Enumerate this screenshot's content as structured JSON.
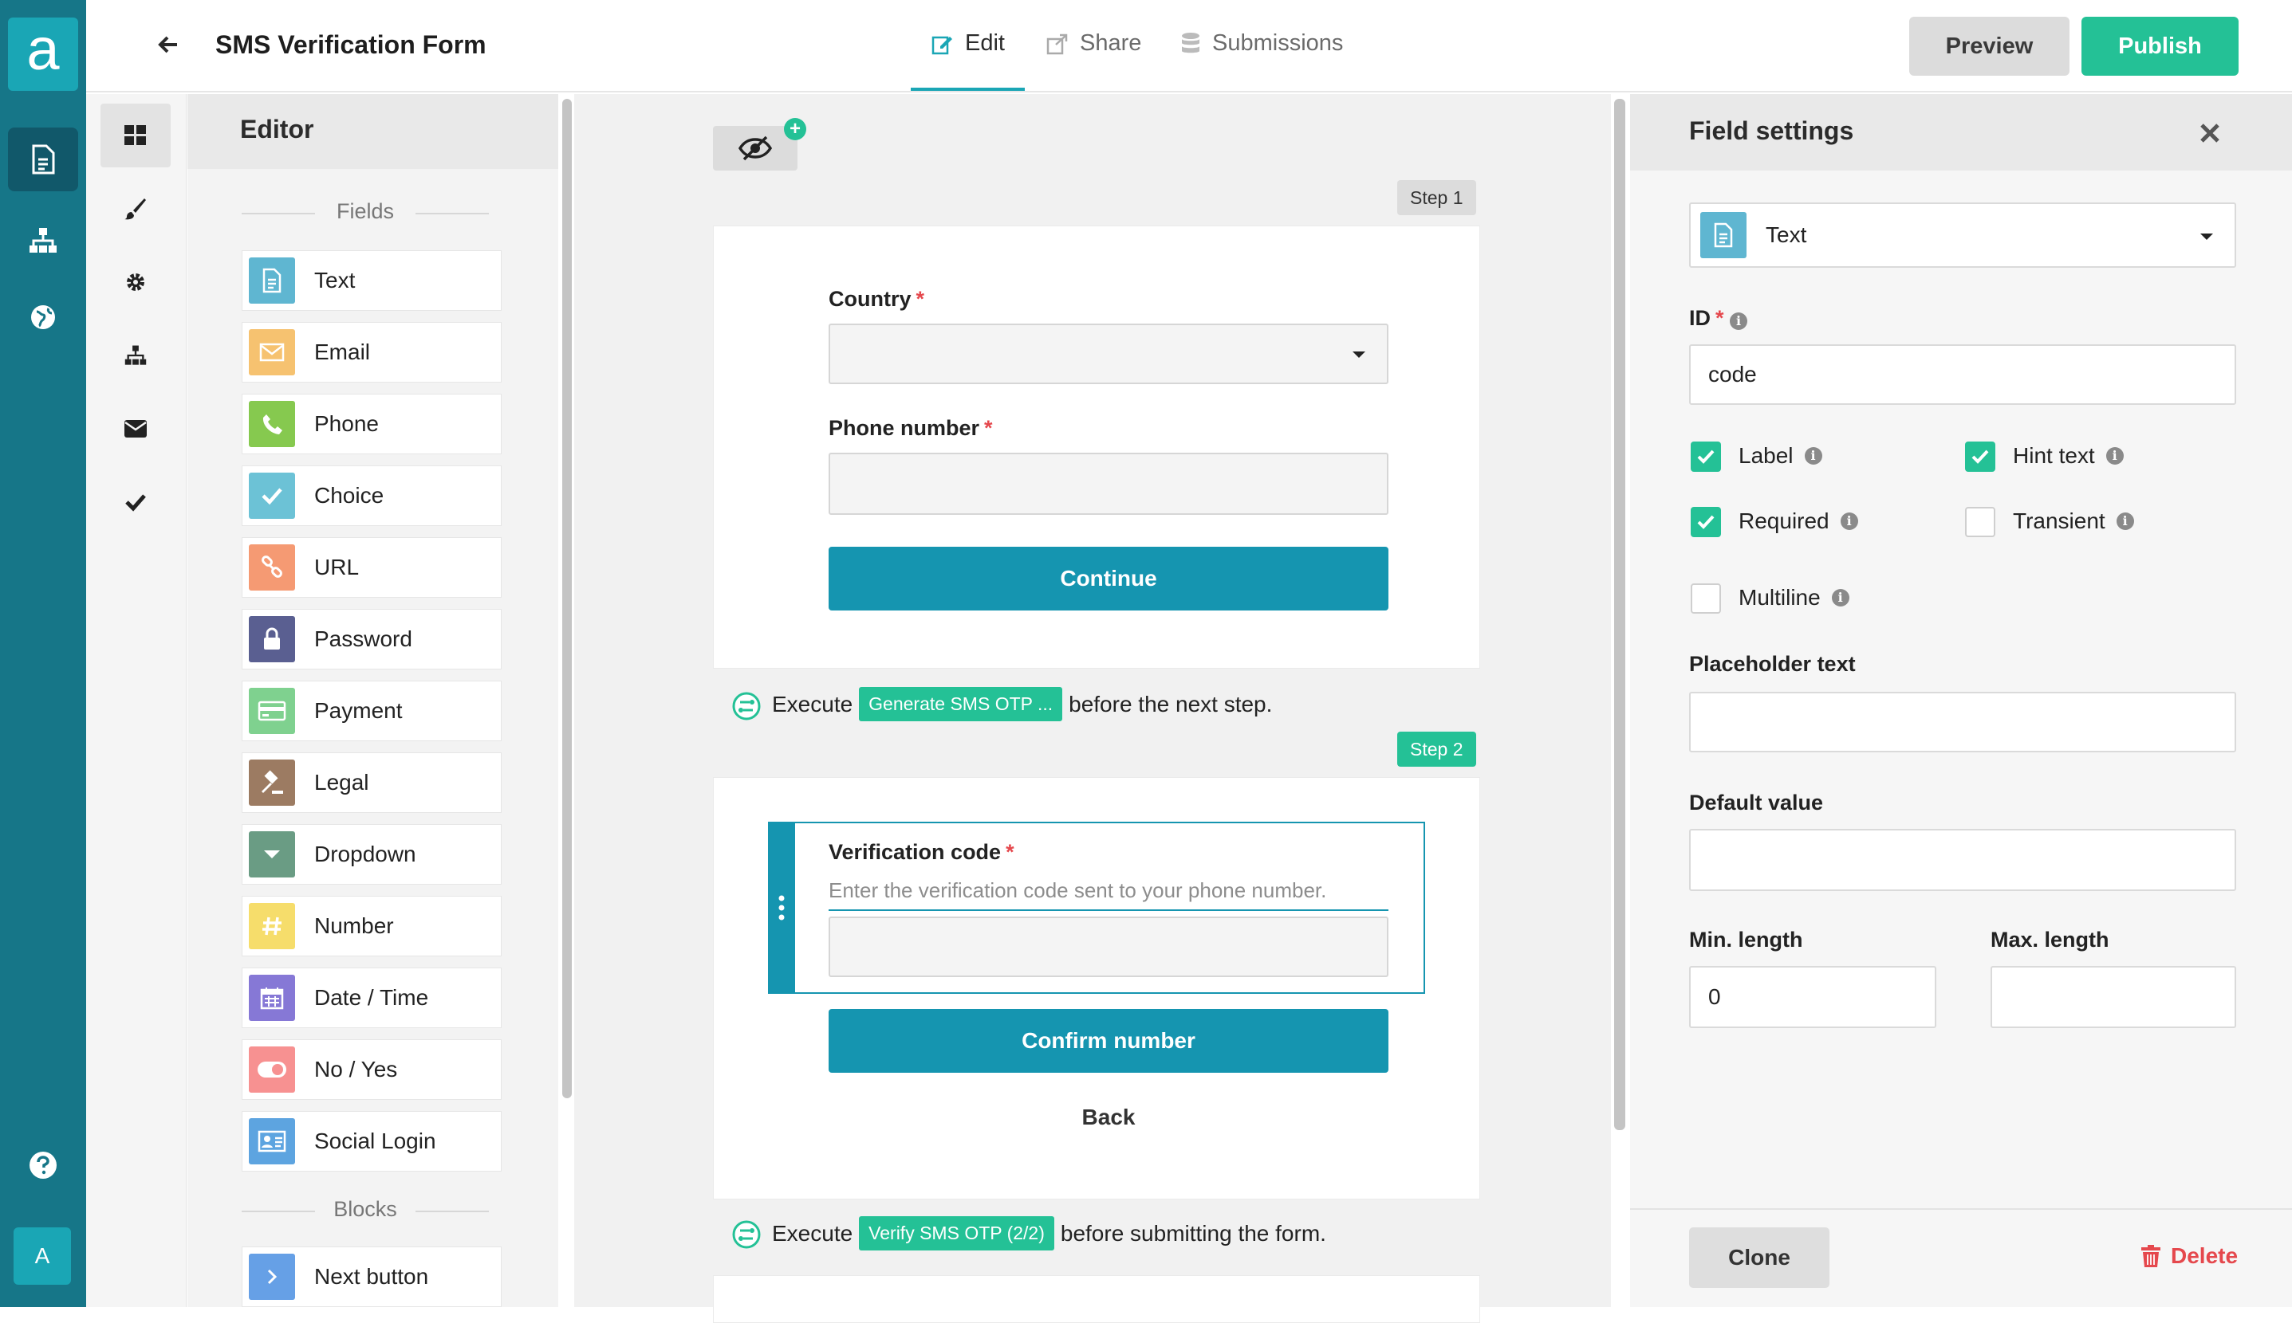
{
  "app": {
    "logo_letter": "a",
    "avatar_initial": "A",
    "accent": "#1aa6b5",
    "rail_color": "#167688",
    "publish_color": "#24c196"
  },
  "header": {
    "title": "SMS Verification Form",
    "tabs": [
      {
        "label": "Edit",
        "active": true
      },
      {
        "label": "Share"
      },
      {
        "label": "Submissions"
      }
    ],
    "preview_label": "Preview",
    "publish_label": "Publish"
  },
  "editor": {
    "title": "Editor",
    "fields_section": "Fields",
    "blocks_section": "Blocks",
    "fields": [
      {
        "label": "Text",
        "icon": "text-doc-icon",
        "color": "#5fb6d1"
      },
      {
        "label": "Email",
        "icon": "envelope-icon",
        "color": "#f6c270"
      },
      {
        "label": "Phone",
        "icon": "phone-icon",
        "color": "#86c94f"
      },
      {
        "label": "Choice",
        "icon": "check-icon",
        "color": "#6cc2d6"
      },
      {
        "label": "URL",
        "icon": "link-icon",
        "color": "#f59a73"
      },
      {
        "label": "Password",
        "icon": "lock-icon",
        "color": "#5a5f91"
      },
      {
        "label": "Payment",
        "icon": "credit-card-icon",
        "color": "#7fd18f"
      },
      {
        "label": "Legal",
        "icon": "gavel-icon",
        "color": "#9c7b62"
      },
      {
        "label": "Dropdown",
        "icon": "caret-down-icon",
        "color": "#6a9c84"
      },
      {
        "label": "Number",
        "icon": "hash-icon",
        "color": "#f6dd6b"
      },
      {
        "label": "Date / Time",
        "icon": "calendar-icon",
        "color": "#8678d6"
      },
      {
        "label": "No / Yes",
        "icon": "toggle-icon",
        "color": "#f79191"
      },
      {
        "label": "Social Login",
        "icon": "id-card-icon",
        "color": "#5da4e0"
      }
    ],
    "blocks": [
      {
        "label": "Next button",
        "icon": "chevron-right-icon",
        "color": "#66a0e6"
      }
    ]
  },
  "canvas": {
    "step1_label": "Step 1",
    "step2_label": "Step 2",
    "country_label": "Country",
    "phone_label": "Phone number",
    "continue_label": "Continue",
    "exec1": {
      "prefix": "Execute",
      "badge": "Generate SMS OTP ...",
      "suffix": "before the next step."
    },
    "code_label": "Verification code",
    "code_hint": "Enter the verification code sent to your phone number.",
    "confirm_label": "Confirm number",
    "back_label": "Back",
    "exec2": {
      "prefix": "Execute",
      "badge": "Verify SMS OTP (2/2)",
      "suffix": "before submitting the form."
    }
  },
  "settings": {
    "title": "Field settings",
    "type_value": "Text",
    "id_label": "ID",
    "id_value": "code",
    "checks": [
      {
        "label": "Label",
        "checked": true
      },
      {
        "label": "Hint text",
        "checked": true
      },
      {
        "label": "Required",
        "checked": true
      },
      {
        "label": "Transient",
        "checked": false
      },
      {
        "label": "Multiline",
        "checked": false
      }
    ],
    "placeholder_label": "Placeholder text",
    "default_label": "Default value",
    "min_label": "Min. length",
    "min_value": "0",
    "max_label": "Max. length",
    "clone_label": "Clone",
    "delete_label": "Delete"
  }
}
